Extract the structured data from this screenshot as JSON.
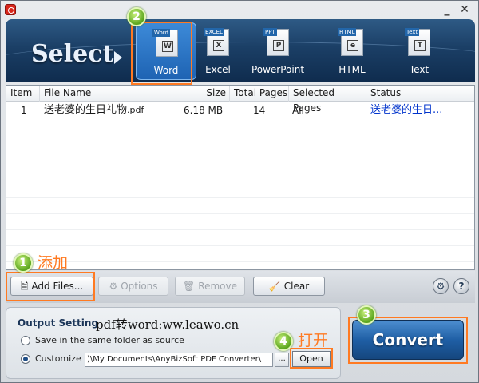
{
  "window": {
    "minimize_label": "_",
    "close_label": "✕"
  },
  "banner": {
    "select_label": "Select",
    "formats": [
      {
        "label": "Word",
        "tag": "Word",
        "glyph": "W",
        "active": true
      },
      {
        "label": "Excel",
        "tag": "EXCEL",
        "glyph": "X",
        "active": false
      },
      {
        "label": "PowerPoint",
        "tag": "PPT",
        "glyph": "P",
        "active": false
      },
      {
        "label": "HTML",
        "tag": "HTML",
        "glyph": "e",
        "active": false
      },
      {
        "label": "Text",
        "tag": "Text",
        "glyph": "T",
        "active": false
      }
    ]
  },
  "table": {
    "columns": [
      "Item",
      "File Name",
      "Size",
      "Total Pages",
      "Selected Pages",
      "Status"
    ],
    "rows": [
      {
        "item": "1",
        "file_name": "送老婆的生日礼物",
        "file_ext": ".pdf",
        "size": "6.18  MB",
        "total_pages": "14",
        "selected_pages": "All",
        "status": "送老婆的生日..."
      }
    ]
  },
  "toolbar": {
    "add_files": "Add Files...",
    "options": "Options",
    "remove": "Remove",
    "clear": "Clear",
    "settings_icon_label": "⚙",
    "help_label": "?"
  },
  "output": {
    "title": "Output Setting",
    "note": "pdf转word:ww.leawo.cn",
    "option_same_folder": "Save in the same folder as source",
    "option_customize": "Customize",
    "selected": "customize",
    "path": ")\\My Documents\\AnyBizSoft PDF Converter\\",
    "browse_label": "...",
    "open_label": "Open"
  },
  "convert_label": "Convert",
  "annotations": {
    "step1": "1",
    "step1_note": "添加",
    "step2": "2",
    "step3": "3",
    "step4": "4",
    "step4_note": "打开",
    "highlight_color": "#ff7a22"
  }
}
